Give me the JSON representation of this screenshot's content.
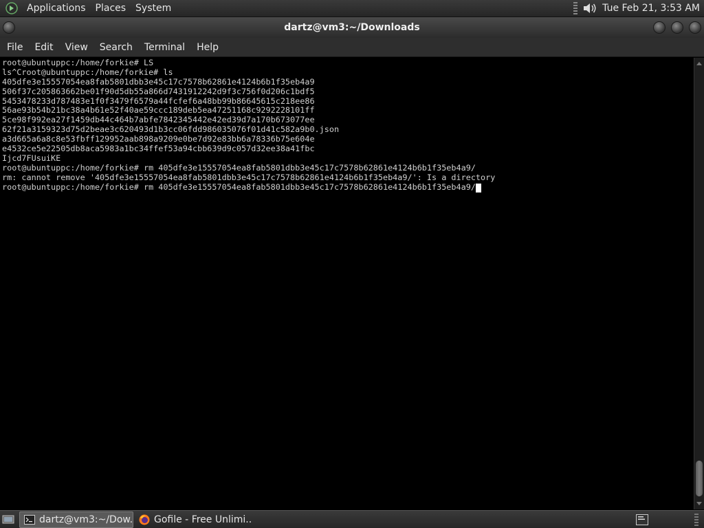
{
  "top_panel": {
    "menus": [
      "Applications",
      "Places",
      "System"
    ],
    "clock": "Tue Feb 21,  3:53 AM"
  },
  "window": {
    "title": "dartz@vm3:~/Downloads"
  },
  "menubar": {
    "items": [
      "File",
      "Edit",
      "View",
      "Search",
      "Terminal",
      "Help"
    ]
  },
  "terminal": {
    "lines": [
      "root@ubuntuppc:/home/forkie# LS",
      "ls^Croot@ubuntuppc:/home/forkie# ls",
      "405dfe3e15557054ea8fab5801dbb3e45c17c7578b62861e4124b6b1f35eb4a9",
      "506f37c205863662be01f90d5db55a866d7431912242d9f3c756f0d206c1bdf5",
      "5453478233d787483e1f0f3479f6579a44fcfef6a48bb99b86645615c218ee86",
      "56ae93b54b21bc38a4b61e52f40ae59ccc189deb5ea47251168c9292228101ff",
      "5ce98f992ea27f1459db44c464b7abfe7842345442e42ed39d7a170b673077ee",
      "62f21a3159323d75d2beae3c620493d1b3cc06fdd986035076f01d41c582a9b0.json",
      "a3d665a6a8c8e53fbff129952aab898a9209e0be7d92e83bb6a78336b75e604e",
      "e4532ce5e22505db8aca5983a1bc34ffef53a94cbb639d9c057d32ee38a41fbc",
      "Ijcd7FUsuiKE",
      "root@ubuntuppc:/home/forkie# rm 405dfe3e15557054ea8fab5801dbb3e45c17c7578b62861e4124b6b1f35eb4a9/",
      "rm: cannot remove '405dfe3e15557054ea8fab5801dbb3e45c17c7578b62861e4124b6b1f35eb4a9/': Is a directory"
    ],
    "current_line": "root@ubuntuppc:/home/forkie# rm 405dfe3e15557054ea8fab5801dbb3e45c17c7578b62861e4124b6b1f35eb4a9/"
  },
  "taskbar": {
    "tasks": [
      {
        "label": "dartz@vm3:~/Dow...",
        "icon": "terminal-icon",
        "active": true
      },
      {
        "label": "Gofile - Free Unlimi...",
        "icon": "firefox-icon",
        "active": false
      }
    ]
  },
  "colors": {
    "terminal_bg": "#000000",
    "terminal_fg": "#d0d0d0",
    "panel_bg": "#2e2e2e"
  }
}
